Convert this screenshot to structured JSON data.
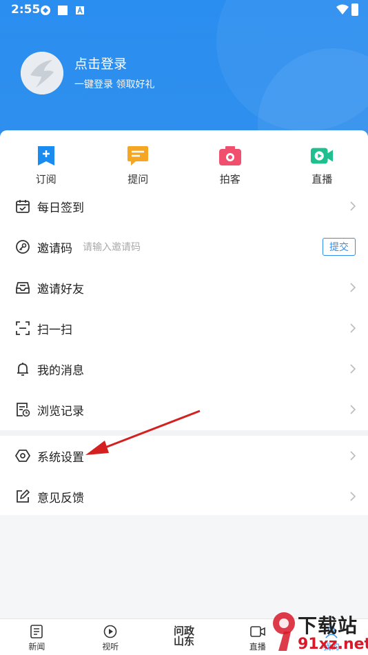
{
  "status_bar": {
    "time": "2:55"
  },
  "profile": {
    "login_text": "点击登录",
    "subtitle": "一键登录 领取好礼"
  },
  "quick_actions": [
    {
      "label": "订阅",
      "icon": "subscribe-icon",
      "color": "#1a8cf0"
    },
    {
      "label": "提问",
      "icon": "question-icon",
      "color": "#f5a623"
    },
    {
      "label": "拍客",
      "icon": "camera-icon",
      "color": "#f0506e"
    },
    {
      "label": "直播",
      "icon": "live-video-icon",
      "color": "#1fbf8f"
    }
  ],
  "menu": [
    {
      "label": "每日签到",
      "icon": "calendar-icon"
    },
    {
      "label": "邀请码",
      "icon": "key-icon",
      "hint": "请输入邀请码",
      "button": "提交"
    },
    {
      "label": "邀请好友",
      "icon": "inbox-icon"
    },
    {
      "label": "扫一扫",
      "icon": "scan-icon"
    },
    {
      "label": "我的消息",
      "icon": "bell-icon"
    },
    {
      "label": "浏览记录",
      "icon": "history-icon"
    },
    {
      "label": "系统设置",
      "icon": "settings-hex-icon"
    },
    {
      "label": "意见反馈",
      "icon": "edit-icon"
    }
  ],
  "bottom_nav": [
    {
      "label": "新闻",
      "icon": "news-icon"
    },
    {
      "label": "视听",
      "icon": "play-icon"
    },
    {
      "label": "问政山东",
      "icon": "wenzheng-logo"
    },
    {
      "label": "直播",
      "icon": "live-icon"
    },
    {
      "label": "我的",
      "icon": "profile-icon"
    }
  ],
  "watermark": {
    "text": "下载站",
    "url": "91xz.net"
  },
  "colors": {
    "header": "#2f8fed",
    "accent": "#2f8fed",
    "annotation_arrow": "#d42020"
  }
}
